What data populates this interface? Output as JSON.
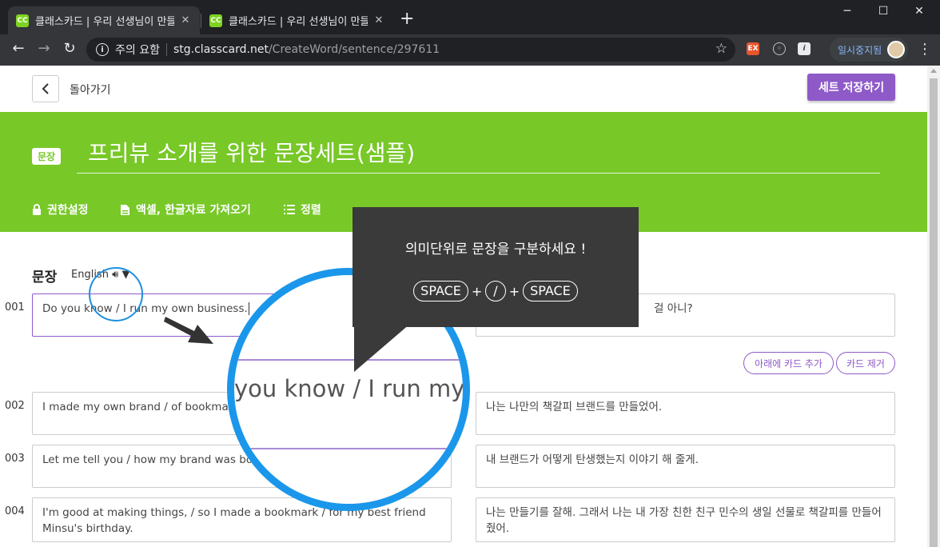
{
  "browser": {
    "tabs": [
      {
        "favicon": "CC",
        "title": "클래스카드 | 우리 선생님이 만들"
      },
      {
        "favicon": "CC",
        "title": "클래스카드 | 우리 선생님이 만들"
      }
    ],
    "url_warning": "주의 요함",
    "url_host": "stg.classcard.net",
    "url_path": "/CreateWord/sentence/297611",
    "profile_name": "일시중지됨"
  },
  "header": {
    "back_label": "돌아가기",
    "save_label": "세트 저장하기"
  },
  "banner": {
    "badge": "문장",
    "title": "프리뷰 소개를 위한 문장세트(샘플)",
    "tools": [
      "권한설정",
      "액셀, 한글자료 가져오기",
      "정렬"
    ]
  },
  "section": {
    "label": "문장",
    "language": "English"
  },
  "rows": [
    {
      "no": "001",
      "sentence": "Do you know / I run my own business.",
      "translation": "걸 아니?"
    },
    {
      "no": "002",
      "sentence": "I made my own brand / of bookmar",
      "translation": "나는 나만의 책갈피 브랜드를 만들었어."
    },
    {
      "no": "003",
      "sentence": "Let me tell you / how my brand was bo",
      "translation": "내 브랜드가 어떻게 탄생했는지 이야기 해 줄게."
    },
    {
      "no": "004",
      "sentence": "I'm good at making things, / so I made a bookmark / for my best friend Minsu's birthday.",
      "translation": "나는 만들기를 잘해. 그래서 나는 내 가장 친한 친구 민수의 생일 선물로 책갈피를 만들어 줬어."
    }
  ],
  "row_actions": {
    "add_below": "아래에 카드 추가",
    "remove": "카드 제거"
  },
  "tooltip": {
    "text": "의미단위로 문장을 구분하세요 !",
    "key1": "SPACE",
    "key2": "/",
    "key3": "SPACE",
    "plus": "+"
  },
  "magnifier_text": "you know / I run my o",
  "colors": {
    "brand_green": "#78c828",
    "accent_purple": "#8e5ac8",
    "highlight_blue": "#1a97ea"
  }
}
